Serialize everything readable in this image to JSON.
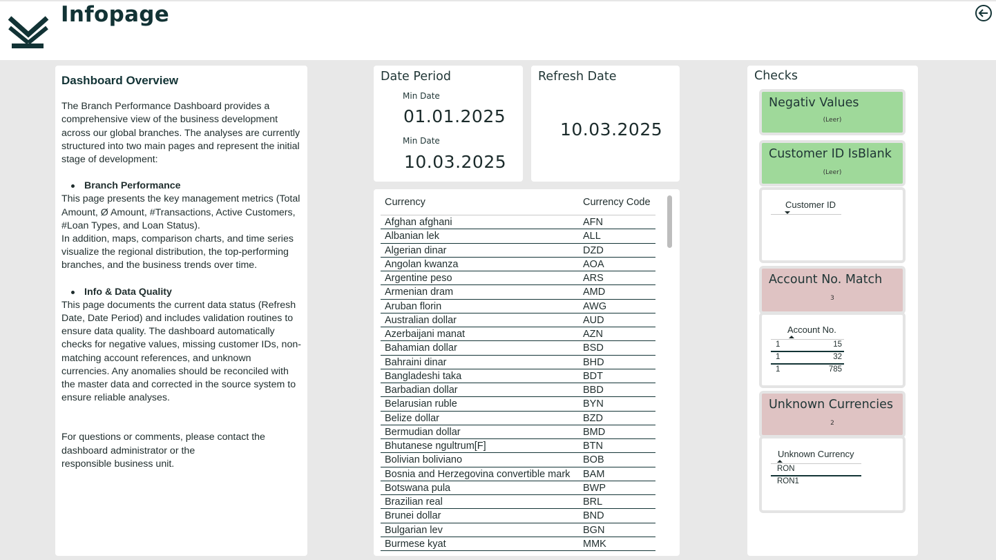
{
  "header": {
    "title": "Infopage",
    "logo_icon": "logo-icon",
    "back_icon": "back-arrow-icon"
  },
  "overview": {
    "title": "Dashboard Overview",
    "intro": "The Branch Performance Dashboard provides a comprehensive view of the business development across our global branches. The analyses are currently structured into two main pages and represent the initial stage of development:",
    "section1_title": "Branch Performance",
    "section1_text1": "This page presents the key management metrics (Total Amount, Ø Amount, #Transactions, Active Customers, #Loan Types, and Loan Status).",
    "section1_text2": "In addition, maps, comparison charts, and time series visualize the regional distribution, the top-performing branches, and the business trends over time.",
    "section2_title": "Info & Data Quality",
    "section2_text": "This page documents the current data status (Refresh Date, Date Period) and includes validation routines to ensure data quality. The dashboard automatically checks for negative values, missing customer IDs, non-matching account references, and unknown currencies. Any anomalies should be reconciled with the master data and corrected in the source system to ensure reliable analyses.",
    "contact_line1": "For questions or comments, please contact the",
    "contact_line2": "dashboard administrator or the",
    "contact_line3": "responsible business unit."
  },
  "date_period": {
    "title": "Date Period",
    "min_label_1": "Min Date",
    "min_value": "01.01.2025",
    "min_label_2": "Min Date",
    "max_value": "10.03.2025"
  },
  "refresh": {
    "title": "Refresh Date",
    "value": "10.03.2025"
  },
  "currency_table": {
    "col_currency": "Currency",
    "col_code": "Currency Code",
    "rows": [
      [
        "Afghan afghani",
        "AFN"
      ],
      [
        "Albanian lek",
        "ALL"
      ],
      [
        "Algerian dinar",
        "DZD"
      ],
      [
        "Angolan kwanza",
        "AOA"
      ],
      [
        "Argentine peso",
        "ARS"
      ],
      [
        "Armenian dram",
        "AMD"
      ],
      [
        "Aruban florin",
        "AWG"
      ],
      [
        "Australian dollar",
        "AUD"
      ],
      [
        "Azerbaijani manat",
        "AZN"
      ],
      [
        "Bahamian dollar",
        "BSD"
      ],
      [
        "Bahraini dinar",
        "BHD"
      ],
      [
        "Bangladeshi taka",
        "BDT"
      ],
      [
        "Barbadian dollar",
        "BBD"
      ],
      [
        "Belarusian ruble",
        "BYN"
      ],
      [
        "Belize dollar",
        "BZD"
      ],
      [
        "Bermudian dollar",
        "BMD"
      ],
      [
        "Bhutanese ngultrum[F]",
        "BTN"
      ],
      [
        "Bolivian boliviano",
        "BOB"
      ],
      [
        "Bosnia and Herzegovina convertible mark",
        "BAM"
      ],
      [
        "Botswana pula",
        "BWP"
      ],
      [
        "Brazilian real",
        "BRL"
      ],
      [
        "Brunei dollar",
        "BND"
      ],
      [
        "Bulgarian lev",
        "BGN"
      ],
      [
        "Burmese kyat",
        "MMK"
      ]
    ]
  },
  "checks": {
    "title": "Checks",
    "negativ": {
      "title": "Negativ Values",
      "value": "(Leer)",
      "color": "#9fd99a"
    },
    "customer_id": {
      "title": "Customer ID IsBlank",
      "value": "(Leer)",
      "color": "#9fd99a"
    },
    "customer_table": {
      "header": "Customer ID"
    },
    "account": {
      "title": "Account No. Match",
      "value": "3",
      "color": "#dfc3c3"
    },
    "account_table": {
      "header": "Account No.",
      "rows": [
        [
          "1",
          "15"
        ],
        [
          "1",
          "32"
        ],
        [
          "1",
          "785"
        ]
      ]
    },
    "unknown": {
      "title": "Unknown Currencies",
      "value": "2",
      "color": "#dfc3c3"
    },
    "unknown_table": {
      "header": "Unknown Currency",
      "rows": [
        "RON",
        "RON1"
      ]
    }
  }
}
